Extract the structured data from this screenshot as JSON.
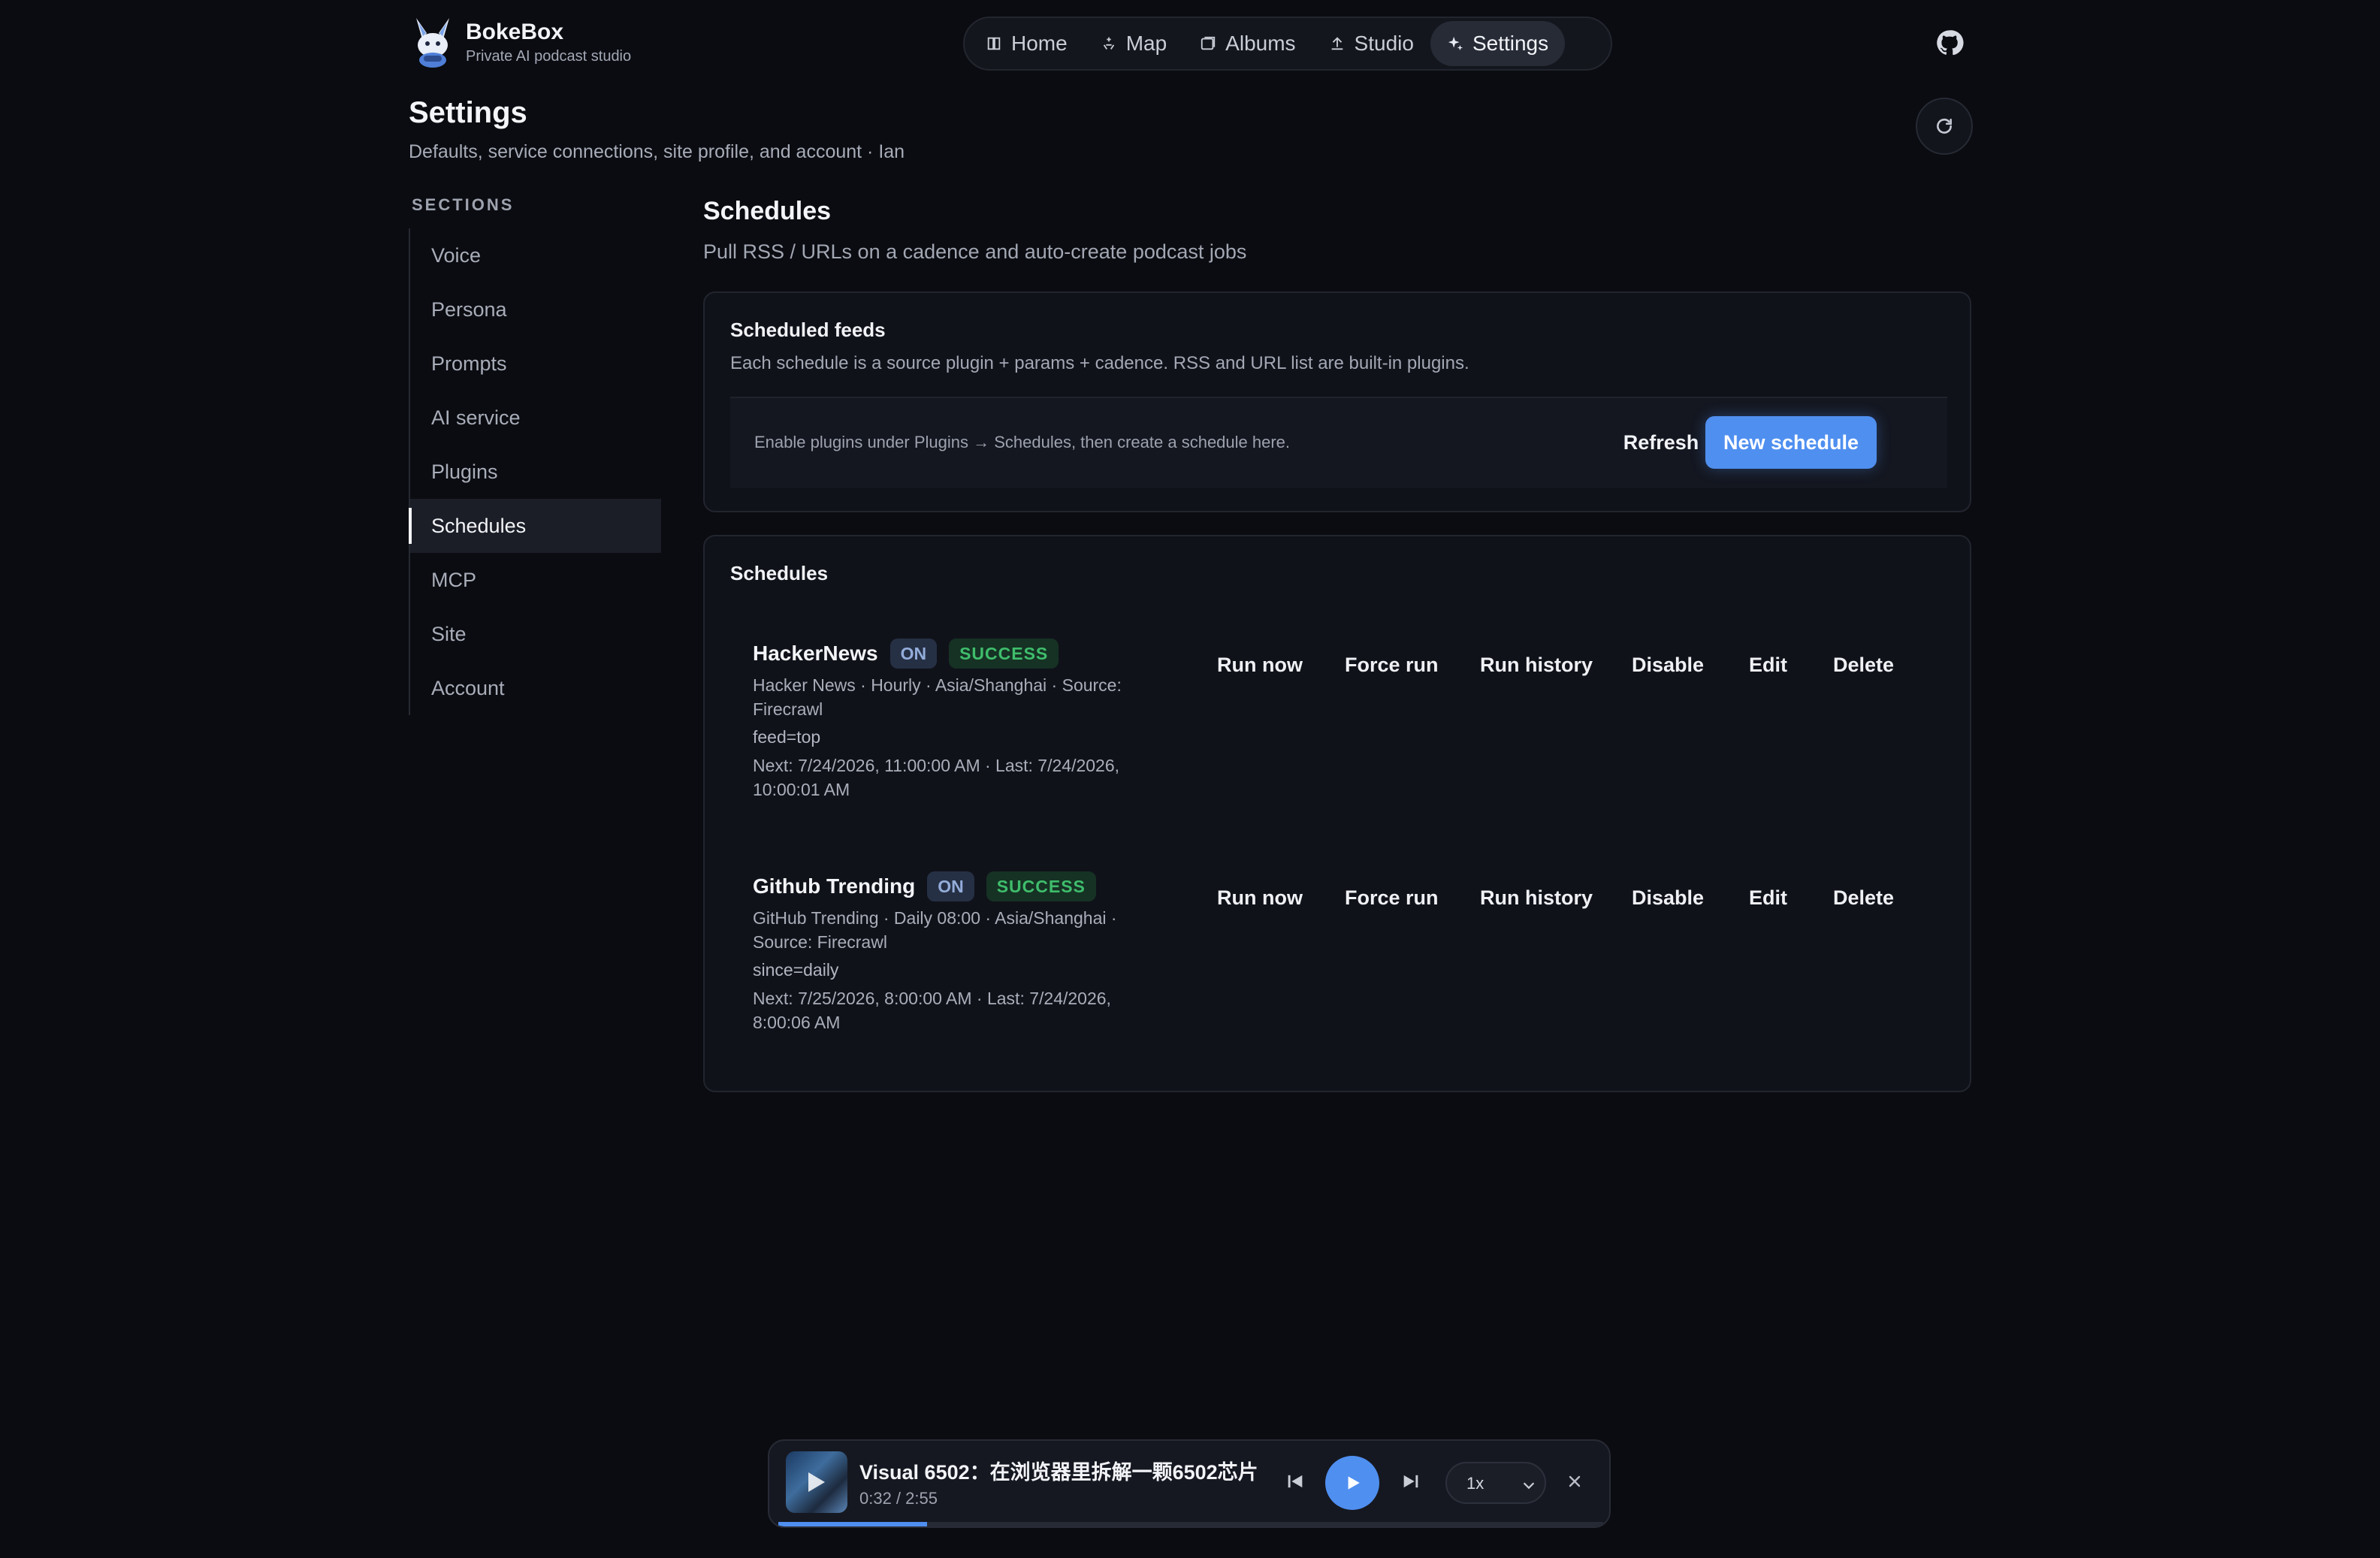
{
  "brand": {
    "name": "BokeBox",
    "tagline": "Private AI podcast studio"
  },
  "nav": [
    {
      "label": "Home",
      "icon": "book-icon"
    },
    {
      "label": "Map",
      "icon": "sparkle-map-icon"
    },
    {
      "label": "Albums",
      "icon": "album-icon"
    },
    {
      "label": "Studio",
      "icon": "upload-icon"
    },
    {
      "label": "Settings",
      "icon": "sparkles-icon",
      "active": true
    }
  ],
  "page": {
    "title": "Settings",
    "subtitle": "Defaults, service connections, site profile, and account · Ian"
  },
  "sidebar": {
    "heading": "SECTIONS",
    "items": [
      "Voice",
      "Persona",
      "Prompts",
      "AI service",
      "Plugins",
      "Schedules",
      "MCP",
      "Site",
      "Account"
    ],
    "active": "Schedules"
  },
  "main": {
    "title": "Schedules",
    "subtitle": "Pull RSS / URLs on a cadence and auto-create podcast jobs"
  },
  "feeds": {
    "title": "Scheduled feeds",
    "description": "Each schedule is a source plugin + params + cadence. RSS and URL list are built-in plugins.",
    "hint": "Enable plugins under Plugins → Schedules, then create a schedule here.",
    "refresh_label": "Refresh",
    "new_label": "New schedule"
  },
  "schedules": {
    "title": "Schedules",
    "actions": [
      "Run now",
      "Force run",
      "Run history",
      "Disable",
      "Edit",
      "Delete"
    ],
    "rows": [
      {
        "name": "HackerNews",
        "state": "ON",
        "status": "SUCCESS",
        "meta": "Hacker News · Hourly · Asia/Shanghai · Source: Firecrawl",
        "params": "feed=top",
        "times": "Next: 7/24/2026, 11:00:00 AM · Last: 7/24/2026, 10:00:01 AM"
      },
      {
        "name": "Github Trending",
        "state": "ON",
        "status": "SUCCESS",
        "meta": "GitHub Trending · Daily 08:00 · Asia/Shanghai · Source: Firecrawl",
        "params": "since=daily",
        "times": "Next: 7/25/2026, 8:00:00 AM · Last: 7/24/2026, 8:00:06 AM"
      }
    ]
  },
  "player": {
    "title": "Visual 6502：在浏览器里拆解一颗6502芯片",
    "time": "0:32 / 2:55",
    "speed": "1x",
    "progress_fraction": 0.18
  },
  "colors": {
    "accent": "#4f8ff0",
    "success": "#3fbd6c",
    "background": "#0b0c11"
  }
}
